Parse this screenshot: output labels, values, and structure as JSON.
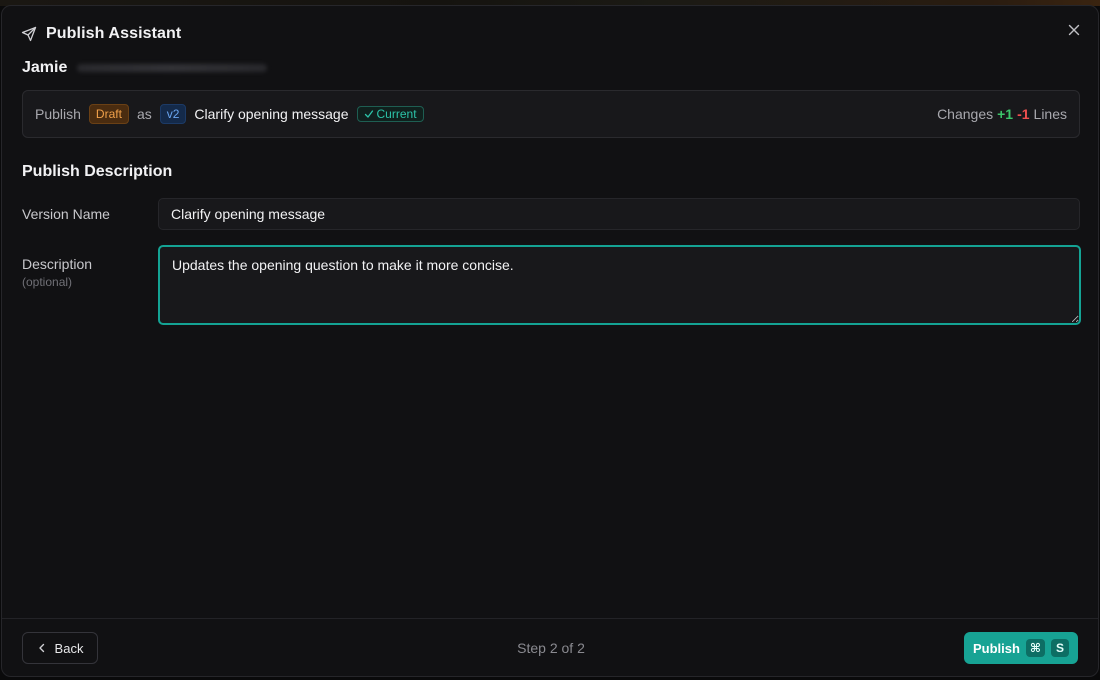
{
  "modal": {
    "title": "Publish Assistant",
    "title_icon": "send-icon",
    "close_icon": "close-icon"
  },
  "assistant": {
    "name": "Jamie"
  },
  "publish_bar": {
    "publish_label": "Publish",
    "draft_badge": "Draft",
    "as_label": "as",
    "version_badge": "v2",
    "version_name": "Clarify opening message",
    "current_badge": "Current",
    "changes_label": "Changes",
    "added": "+1",
    "removed": "-1",
    "lines_label": "Lines"
  },
  "form": {
    "section_title": "Publish Description",
    "version_name_label": "Version Name",
    "version_name_value": "Clarify opening message",
    "description_label": "Description",
    "description_optional": "(optional)",
    "description_value": "Updates the opening question to make it more concise."
  },
  "footer": {
    "back_label": "Back",
    "step_text": "Step 2 of 2",
    "publish_label": "Publish",
    "shortcut_cmd": "⌘",
    "shortcut_key": "S"
  },
  "colors": {
    "accent": "#17a394",
    "draft": "#f0a04a",
    "version": "#6aa5f0",
    "added": "#3cc46a",
    "removed": "#ef4f4f"
  }
}
